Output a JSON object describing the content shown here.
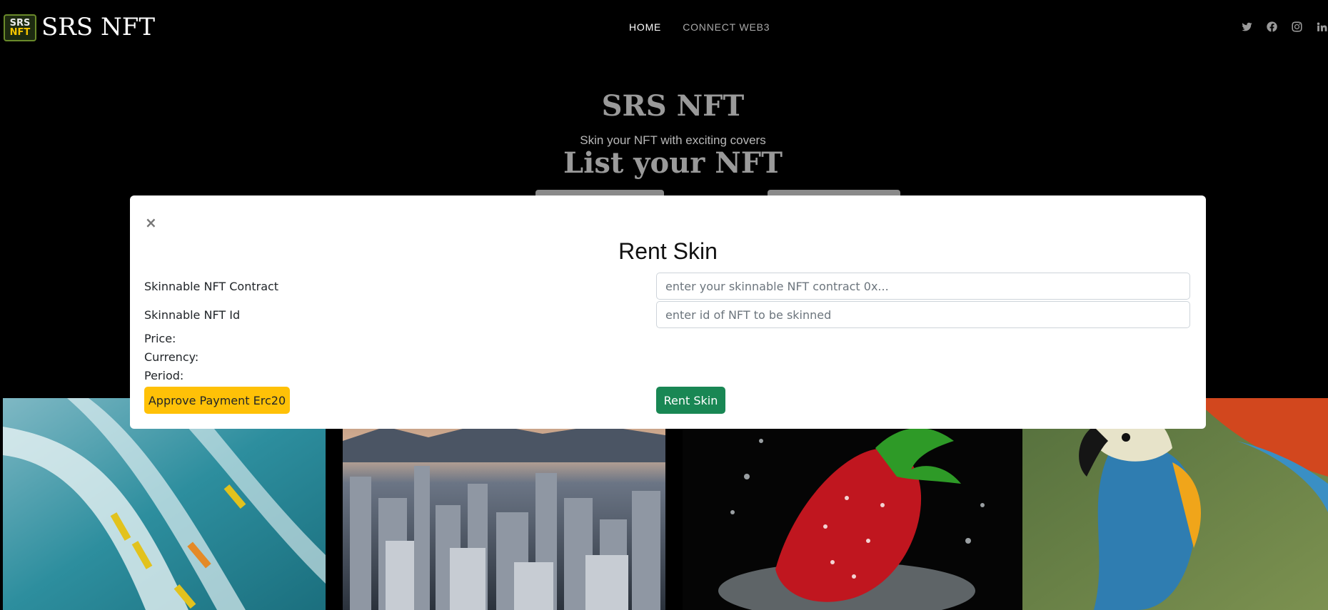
{
  "nav": {
    "logo_line1": "SRS",
    "logo_line2": "NFT",
    "brand": "SRS NFT",
    "links": [
      {
        "label": "HOME",
        "active": true
      },
      {
        "label": "CONNECT WEB3",
        "active": false
      }
    ],
    "social_icons": [
      "twitter-icon",
      "facebook-icon",
      "instagram-icon",
      "linkedin-icon"
    ]
  },
  "hero": {
    "title": "SRS NFT",
    "subtitle": "Skin your NFT with exciting covers",
    "list_heading": "List your NFT"
  },
  "modal": {
    "close_label": "×",
    "title": "Rent Skin",
    "fields": [
      {
        "label": "Skinnable NFT Contract",
        "placeholder": "enter your skinnable NFT contract 0x...",
        "value": ""
      },
      {
        "label": "Skinnable NFT Id",
        "placeholder": "enter id of NFT to be skinned",
        "value": ""
      }
    ],
    "info": {
      "price_label": "Price:",
      "currency_label": "Currency:",
      "period_label": "Period:"
    },
    "approve_button": "Approve Payment Erc20",
    "rent_button": "Rent Skin"
  },
  "gallery": {
    "tiles": [
      "surfers-image",
      "city-skyline-image",
      "strawberry-splash-image",
      "parrot-image"
    ]
  },
  "colors": {
    "background": "#000000",
    "approve": "#ffc107",
    "rent": "#198754",
    "modal_bg": "#ffffff"
  }
}
